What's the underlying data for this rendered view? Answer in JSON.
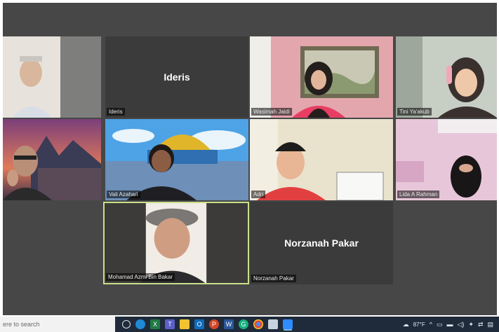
{
  "participants": [
    {
      "name": "Ideris"
    },
    {
      "name": "Wasimah Jaidi"
    },
    {
      "name": "Tini Ya'akub"
    },
    {
      "name": "Vali Azahari"
    },
    {
      "name": "Adri"
    },
    {
      "name": "Lida A Rahman"
    },
    {
      "name": "Mohamad Azmi Bin Bakar"
    },
    {
      "name": "Norzanah Pakar"
    }
  ],
  "taskbar": {
    "search_placeholder": "ere to search",
    "temperature": "87°F",
    "apps": [
      "task-view",
      "edge",
      "excel",
      "teams",
      "file-explorer",
      "outlook",
      "powerpoint",
      "word",
      "grammarly",
      "chrome",
      "mail",
      "zoom"
    ]
  },
  "colors": {
    "speaking_border": "#c9df8a",
    "grid_background": "#474747",
    "taskbar": "#1f2b3a"
  }
}
